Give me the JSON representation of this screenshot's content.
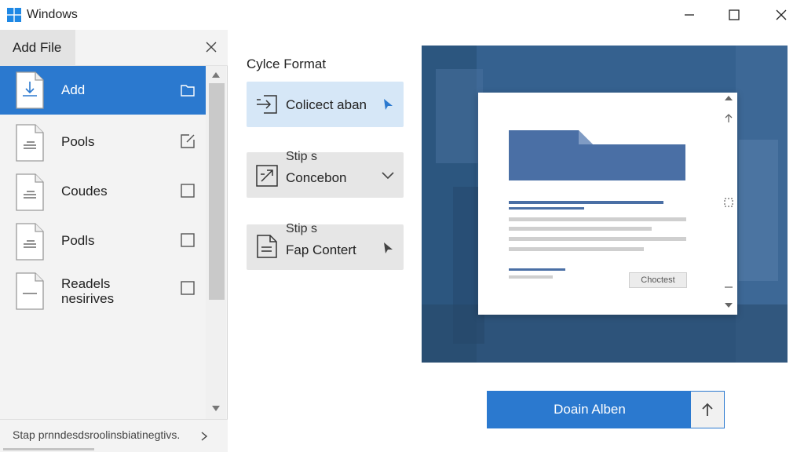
{
  "window": {
    "title": "Windows"
  },
  "panel": {
    "tab_label": "Add File",
    "items": [
      {
        "label": "Add",
        "selected": true
      },
      {
        "label": "Pools",
        "selected": false
      },
      {
        "label": "Coudes",
        "selected": false
      },
      {
        "label": "Podls",
        "selected": false
      },
      {
        "label": "Readels nesirives",
        "line1": "Readels",
        "line2": "nesirives",
        "selected": false
      }
    ],
    "footer_text": "Stap prnndesdsroolinsbiatinegtivs."
  },
  "format": {
    "title": "Cylce Format",
    "options": [
      {
        "label": "Colicect aban",
        "active": true
      },
      {
        "small": "Stip s",
        "label": "Concebon",
        "active": false
      },
      {
        "small": "Stip s",
        "label": "Fap Contert",
        "active": false
      }
    ]
  },
  "preview": {
    "card_button": "Choctest"
  },
  "actions": {
    "primary_label": "Doain Alben"
  },
  "colors": {
    "accent": "#2b79cf",
    "preview_bg": "#2f5b8f",
    "doc_blue": "#4a6fa5"
  }
}
